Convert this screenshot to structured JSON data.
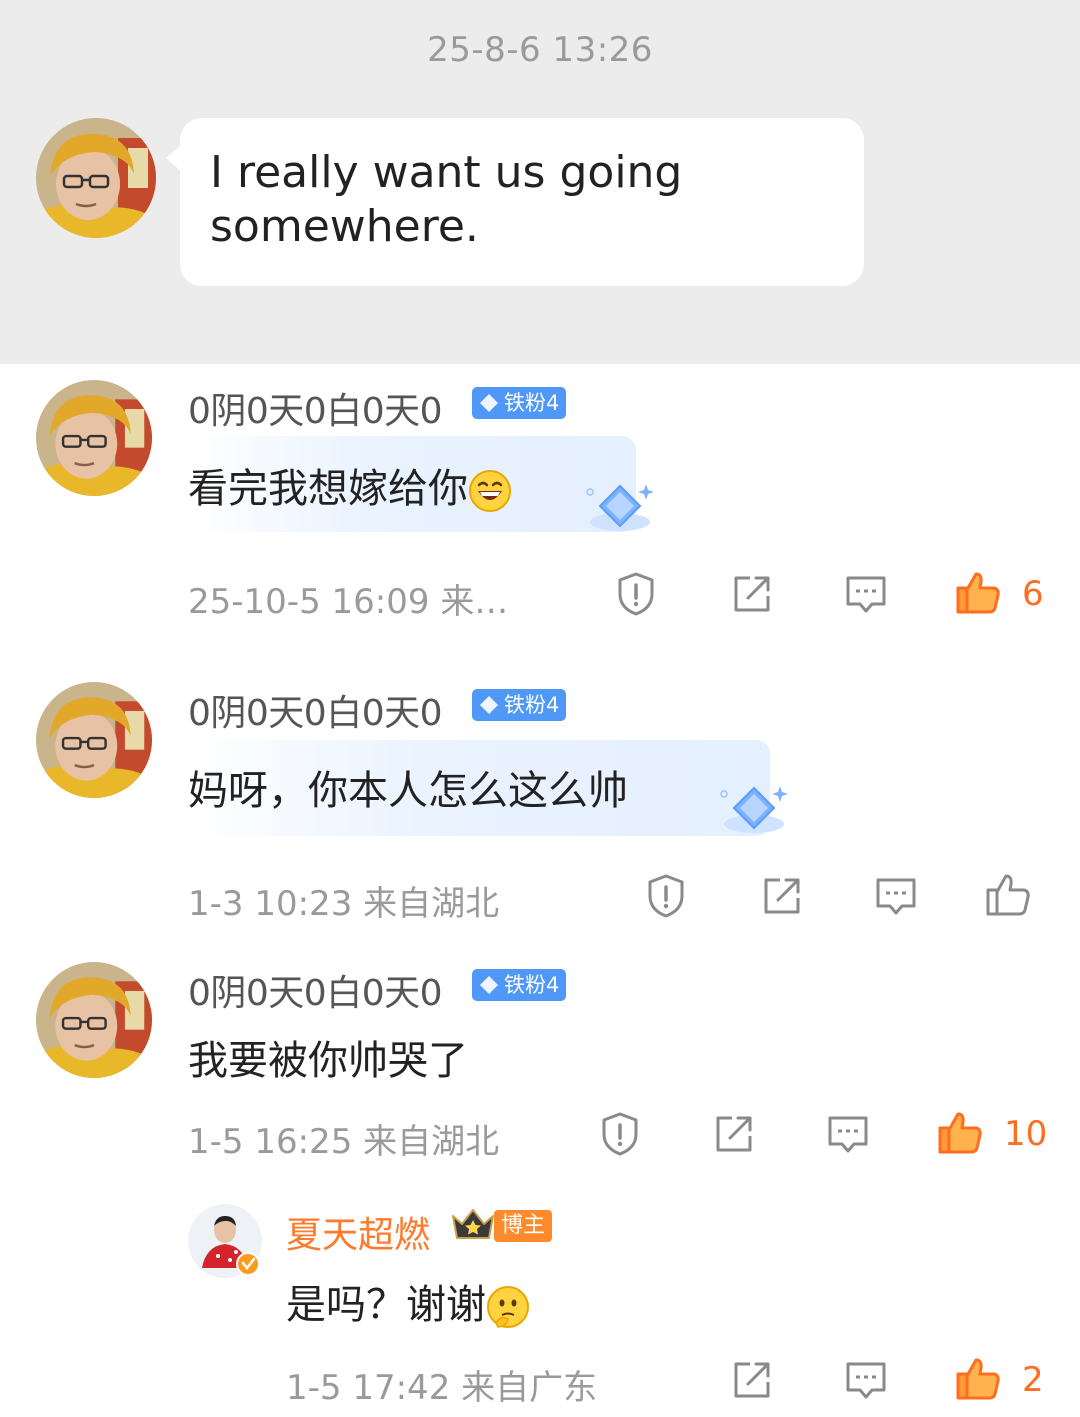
{
  "dm": {
    "timestamp": "25-8-6 13:26",
    "message": "I really want us going somewhere."
  },
  "colors": {
    "accent": "#ff6d20",
    "badge_blue": "#4f98f7",
    "owner_orange": "#ff7a2a",
    "bg_gray": "#ececec"
  },
  "comments": [
    {
      "username": "0阴0天0白0天0",
      "badge": "铁粉4",
      "text": "看完我想嫁给你",
      "emoji": "laughing-emoji",
      "time": "25-10-5 16:09",
      "location": "来…",
      "likes": "6"
    },
    {
      "username": "0阴0天0白0天0",
      "badge": "铁粉4",
      "text": "妈呀，你本人怎么这么帅",
      "time": "1-3 10:23",
      "location": "来自湖北",
      "likes": ""
    },
    {
      "username": "0阴0天0白0天0",
      "badge": "铁粉4",
      "text": "我要被你帅哭了",
      "time": "1-5 16:25",
      "location": "来自湖北",
      "likes": "10"
    }
  ],
  "reply": {
    "username": "夏天超燃",
    "badge": "博主",
    "text": "是吗？谢谢",
    "emoji": "thinking-emoji",
    "time": "1-5 17:42",
    "location": "来自广东",
    "likes": "2"
  }
}
